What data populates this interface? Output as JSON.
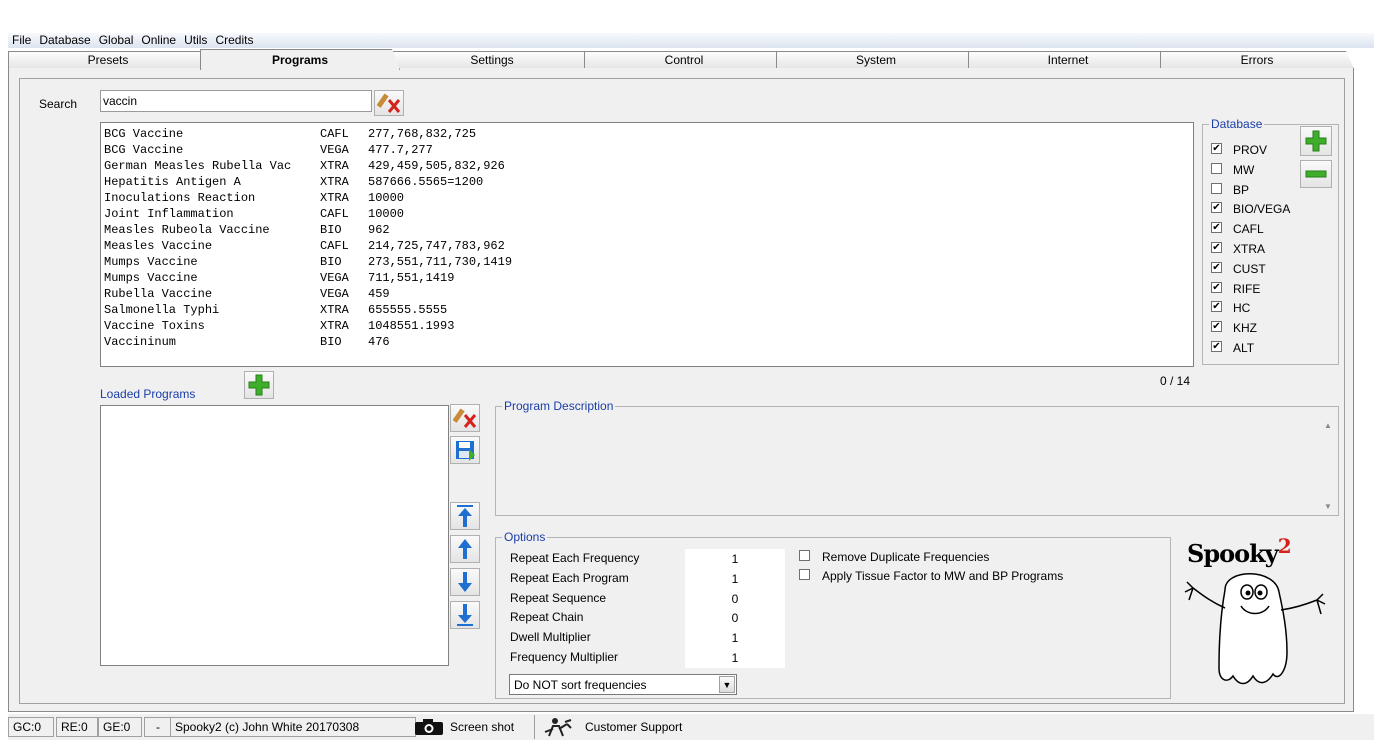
{
  "menu": [
    "File",
    "Database",
    "Global",
    "Online",
    "Utils",
    "Credits"
  ],
  "tabs": [
    "Presets",
    "Programs",
    "Settings",
    "Control",
    "System",
    "Internet",
    "Errors"
  ],
  "active_tab": "Programs",
  "search": {
    "label": "Search",
    "value": "vaccin"
  },
  "results": [
    {
      "name": "BCG Vaccine",
      "db": "CAFL",
      "freq": "277,768,832,725"
    },
    {
      "name": "BCG Vaccine",
      "db": "VEGA",
      "freq": "477.7,277"
    },
    {
      "name": "German Measles Rubella Vac",
      "db": "XTRA",
      "freq": "429,459,505,832,926"
    },
    {
      "name": "Hepatitis Antigen A",
      "db": "XTRA",
      "freq": "587666.5565=1200"
    },
    {
      "name": "Inoculations Reaction",
      "db": "XTRA",
      "freq": "10000"
    },
    {
      "name": "Joint Inflammation",
      "db": "CAFL",
      "freq": "10000"
    },
    {
      "name": "Measles Rubeola Vaccine",
      "db": "BIO",
      "freq": "962"
    },
    {
      "name": "Measles Vaccine",
      "db": "CAFL",
      "freq": "214,725,747,783,962"
    },
    {
      "name": "Mumps Vaccine",
      "db": "BIO",
      "freq": "273,551,711,730,1419"
    },
    {
      "name": "Mumps Vaccine",
      "db": "VEGA",
      "freq": "711,551,1419"
    },
    {
      "name": "Rubella Vaccine",
      "db": "VEGA",
      "freq": "459"
    },
    {
      "name": "Salmonella Typhi",
      "db": "XTRA",
      "freq": "655555.5555"
    },
    {
      "name": "Vaccine Toxins",
      "db": "XTRA",
      "freq": "1048551.1993"
    },
    {
      "name": "Vaccininum",
      "db": "BIO",
      "freq": "476"
    }
  ],
  "database": {
    "title": "Database",
    "items": [
      {
        "label": "PROV",
        "checked": true
      },
      {
        "label": "MW",
        "checked": false
      },
      {
        "label": "BP",
        "checked": false
      },
      {
        "label": "BIO/VEGA",
        "checked": true
      },
      {
        "label": "CAFL",
        "checked": true
      },
      {
        "label": "XTRA",
        "checked": true
      },
      {
        "label": "CUST",
        "checked": true
      },
      {
        "label": "RIFE",
        "checked": true
      },
      {
        "label": "HC",
        "checked": true
      },
      {
        "label": "KHZ",
        "checked": true
      },
      {
        "label": "ALT",
        "checked": true
      }
    ]
  },
  "count": "0 / 14",
  "loaded_programs_label": "Loaded Programs",
  "program_description_label": "Program Description",
  "options": {
    "title": "Options",
    "rows": [
      {
        "label": "Repeat Each Frequency",
        "value": "1"
      },
      {
        "label": "Repeat Each Program",
        "value": "1"
      },
      {
        "label": "Repeat Sequence",
        "value": "0"
      },
      {
        "label": "Repeat Chain",
        "value": "0"
      },
      {
        "label": "Dwell Multiplier",
        "value": "1"
      },
      {
        "label": "Frequency Multiplier",
        "value": "1"
      }
    ],
    "remove_duplicates": "Remove Duplicate Frequencies",
    "apply_tissue": "Apply Tissue Factor to MW and BP Programs",
    "sort_value": "Do NOT sort frequencies"
  },
  "logo": {
    "text": "Spooky",
    "sup": "2"
  },
  "status": {
    "gc": "GC:0",
    "re": "RE:0",
    "ge": "GE:0",
    "dash": "-",
    "copyright": "Spooky2 (c) John White 20170308",
    "screenshot": "Screen shot",
    "support": "Customer Support"
  },
  "colors": {
    "accent_blue": "#1a3ea6",
    "plus_green": "#3fae2a",
    "arrow_blue": "#1f6fd1"
  }
}
